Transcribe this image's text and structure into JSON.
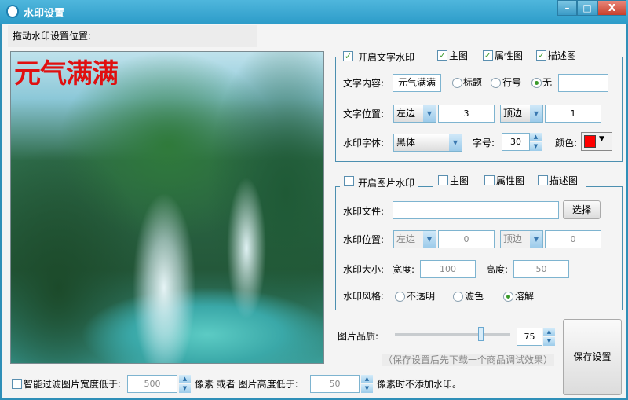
{
  "window": {
    "title": "水印设置",
    "minimize": "–",
    "maximize": "□",
    "close": "X"
  },
  "preview": {
    "label": "拖动水印设置位置:",
    "watermark_text": "元气满满"
  },
  "text_wm": {
    "enable_label": "开启文字水印",
    "enabled": true,
    "targets": [
      {
        "label": "主图",
        "checked": true
      },
      {
        "label": "属性图",
        "checked": true
      },
      {
        "label": "描述图",
        "checked": true
      }
    ],
    "content_label": "文字内容:",
    "content_value": "元气满满",
    "radios": [
      {
        "label": "标题",
        "selected": false
      },
      {
        "label": "行号",
        "selected": false
      },
      {
        "label": "无",
        "selected": true
      }
    ],
    "extra_value": "",
    "position_label": "文字位置:",
    "h_align": "左边",
    "h_offset": "3",
    "v_align": "顶边",
    "v_offset": "1",
    "font_label": "水印字体:",
    "font_value": "黑体",
    "size_label": "字号:",
    "size_value": "30",
    "color_label": "颜色:",
    "color": "#ff0000"
  },
  "image_wm": {
    "enable_label": "开启图片水印",
    "enabled": false,
    "targets": [
      {
        "label": "主图",
        "checked": false
      },
      {
        "label": "属性图",
        "checked": false
      },
      {
        "label": "描述图",
        "checked": false
      }
    ],
    "file_label": "水印文件:",
    "file_value": "",
    "choose_button": "选择",
    "position_label": "水印位置:",
    "h_align": "左边",
    "h_offset": "0",
    "v_align": "顶边",
    "v_offset": "0",
    "size_label": "水印大小:",
    "width_label": "宽度:",
    "width_value": "100",
    "height_label": "高度:",
    "height_value": "50",
    "style_label": "水印风格:",
    "styles": [
      {
        "label": "不透明",
        "selected": false
      },
      {
        "label": "滤色",
        "selected": false
      },
      {
        "label": "溶解",
        "selected": true
      }
    ]
  },
  "quality": {
    "label": "图片品质:",
    "value": "75",
    "slider_percent": 75,
    "hint": "（保存设置后先下载一个商品调试效果）"
  },
  "save_button": "保存设置",
  "filter": {
    "label": "智能过滤图片宽度低于:",
    "checked": false,
    "width_value": "500",
    "mid_text": "像素 或者 图片高度低于:",
    "height_value": "50",
    "end_text": "像素时不添加水印。"
  }
}
